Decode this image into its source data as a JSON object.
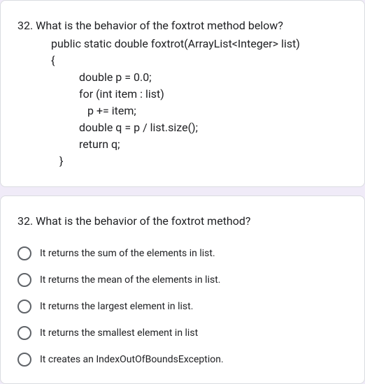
{
  "question1": {
    "title": "32. What is the behavior of the foxtrot method below?",
    "code": {
      "line1": "public static double foxtrot(ArrayList<Integer> list)",
      "line2": "{",
      "line3": "double p = 0.0;",
      "line4": "for (int item : list)",
      "line5": "p += item;",
      "line6": "double q = p / list.size();",
      "line7": "return q;",
      "line8": "}"
    }
  },
  "question2": {
    "title": "32. What is the behavior of the foxtrot method?",
    "options": [
      "It returns the sum of the elements in list.",
      "It returns the mean of the elements in list.",
      "It returns the largest element in list.",
      "It returns the smallest element in list",
      "It creates an IndexOutOfBoundsException."
    ]
  }
}
